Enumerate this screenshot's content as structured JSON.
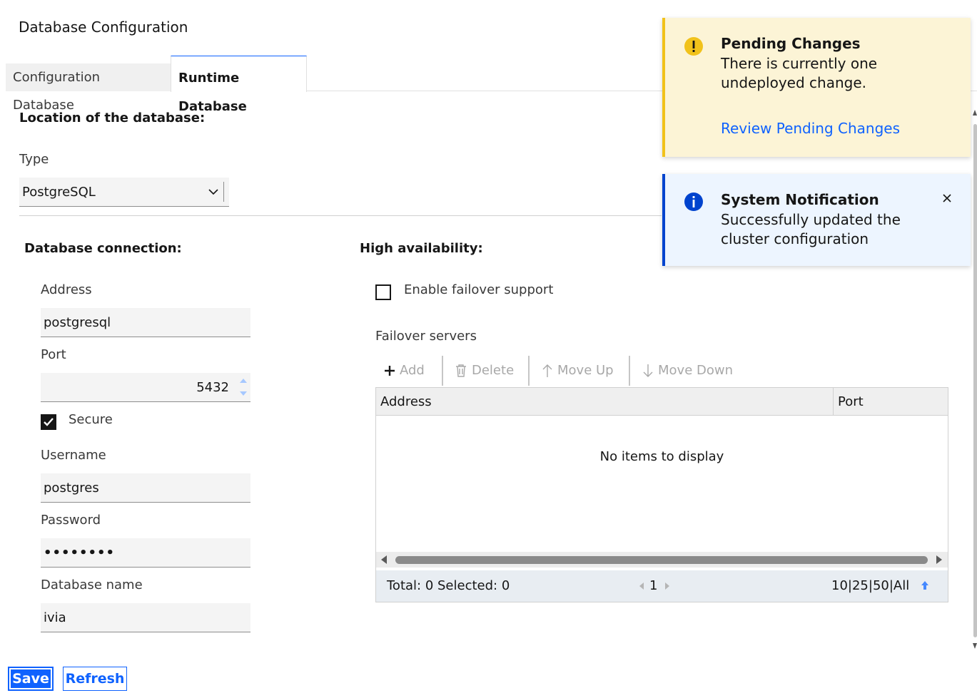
{
  "page": {
    "title": "Database Configuration"
  },
  "tabs": [
    {
      "label": "Configuration Database"
    },
    {
      "label": "Runtime Database"
    }
  ],
  "location": {
    "heading": "Location of the database:",
    "type_label": "Type",
    "type_value": "PostgreSQL"
  },
  "connection": {
    "heading": "Database connection:",
    "address_label": "Address",
    "address_value": "postgresql",
    "port_label": "Port",
    "port_value": "5432",
    "secure_label": "Secure",
    "secure_checked": true,
    "username_label": "Username",
    "username_value": "postgres",
    "password_label": "Password",
    "password_value": "••••••••",
    "dbname_label": "Database name",
    "dbname_value": "ivia"
  },
  "ha": {
    "heading": "High availability:",
    "failover_label": "Enable failover support",
    "failover_checked": false,
    "servers_label": "Failover servers",
    "toolbar": {
      "add": "Add",
      "delete": "Delete",
      "move_up": "Move Up",
      "move_down": "Move Down"
    },
    "grid": {
      "columns": [
        "Address",
        "Port"
      ],
      "empty_text": "No items to display",
      "total_text": "Total: 0 Selected: 0",
      "page": "1",
      "page_sizes": "10|25|50|All"
    }
  },
  "notifications": {
    "pending": {
      "title": "Pending Changes",
      "body": "There is currently one undeployed change.",
      "link": "Review Pending Changes"
    },
    "system": {
      "title": "System Notification",
      "body": "Successfully updated the cluster configuration"
    }
  },
  "actions": {
    "save": "Save",
    "refresh": "Refresh"
  },
  "colors": {
    "accent": "#0f62fe",
    "warning": "#f1c21b",
    "info": "#0043ce"
  }
}
